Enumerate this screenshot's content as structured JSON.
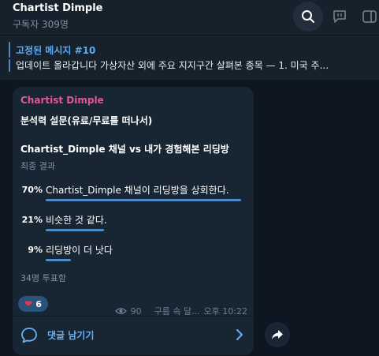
{
  "header": {
    "title": "Chartist Dimple",
    "subtitle": "구독자 309명"
  },
  "pinned": {
    "title": "고정된 메시지 #10",
    "text": "업데이트 올라갑니다 가상자산 외에 주요 지지구간 살펴본 종목 — 1. 미국 주..."
  },
  "post": {
    "author": "Chartist Dimple",
    "question": "분석력 설문(유료/무료를 떠나서)",
    "poll": {
      "title": "Chartist_Dimple 채널 vs 내가 경험해본 리딩방",
      "subtitle": "최종 결과",
      "options": [
        {
          "percent_label": "70%",
          "percent": 70,
          "text": "Chartist_Dimple 채널이 리딩방을 상회한다."
        },
        {
          "percent_label": "21%",
          "percent": 21,
          "text": "비슷한 것 같다."
        },
        {
          "percent_label": "9%",
          "percent": 9,
          "text": "리딩방이 더 낫다"
        }
      ],
      "votes": "34명 투표함"
    },
    "reaction": {
      "emoji": "heart",
      "count": "6"
    },
    "views": "90",
    "signature": "구름 속 달...",
    "time": "오후 10:22",
    "comments_label": "댓글 남기기"
  },
  "colors": {
    "background": "#0e1621",
    "panel": "#17212b",
    "bubble": "#182533",
    "accent": "#5288c1",
    "author": "#e2579c",
    "bar": "#4f8bc9"
  }
}
